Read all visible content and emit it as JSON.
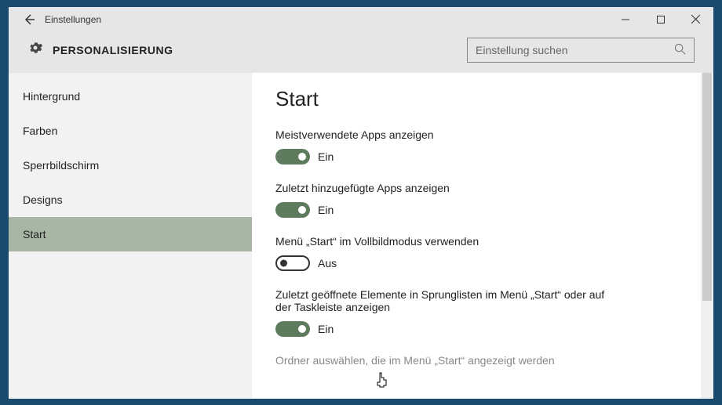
{
  "window": {
    "title": "Einstellungen"
  },
  "header": {
    "category": "PERSONALISIERUNG",
    "search_placeholder": "Einstellung suchen"
  },
  "sidebar": {
    "items": [
      {
        "label": "Hintergrund",
        "active": false
      },
      {
        "label": "Farben",
        "active": false
      },
      {
        "label": "Sperrbildschirm",
        "active": false
      },
      {
        "label": "Designs",
        "active": false
      },
      {
        "label": "Start",
        "active": true
      }
    ]
  },
  "page": {
    "title": "Start",
    "options": [
      {
        "label": "Meistverwendete Apps anzeigen",
        "on": true,
        "state": "Ein"
      },
      {
        "label": "Zuletzt hinzugefügte Apps anzeigen",
        "on": true,
        "state": "Ein"
      },
      {
        "label": "Menü „Start“ im Vollbildmodus verwenden",
        "on": false,
        "state": "Aus"
      },
      {
        "label": "Zuletzt geöffnete Elemente in Sprunglisten im Menü „Start“ oder auf der Taskleiste anzeigen",
        "on": true,
        "state": "Ein"
      }
    ],
    "link": "Ordner auswählen, die im Menü „Start“ angezeigt werden"
  }
}
